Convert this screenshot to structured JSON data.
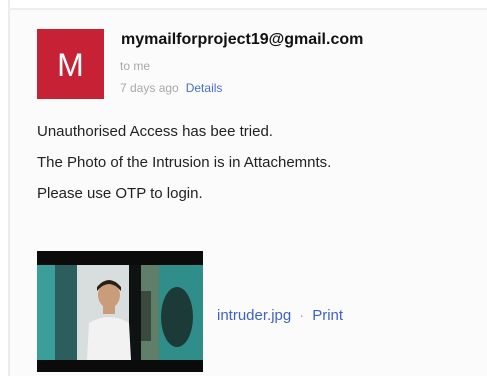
{
  "email": {
    "avatar_letter": "M",
    "avatar_color": "#c72135",
    "sender": "mymailforproject19@gmail.com",
    "recipient": "to me",
    "timestamp": "7 days ago",
    "details_label": "Details",
    "body_lines": [
      "Unauthorised Access has bee tried.",
      "The Photo of the Intrusion is in Attachemnts.",
      "Please use OTP to login."
    ]
  },
  "attachment": {
    "filename": "intruder.jpg",
    "separator": "·",
    "print_label": "Print"
  },
  "colors": {
    "link": "#3f63c0",
    "muted": "#a8a8a8"
  }
}
